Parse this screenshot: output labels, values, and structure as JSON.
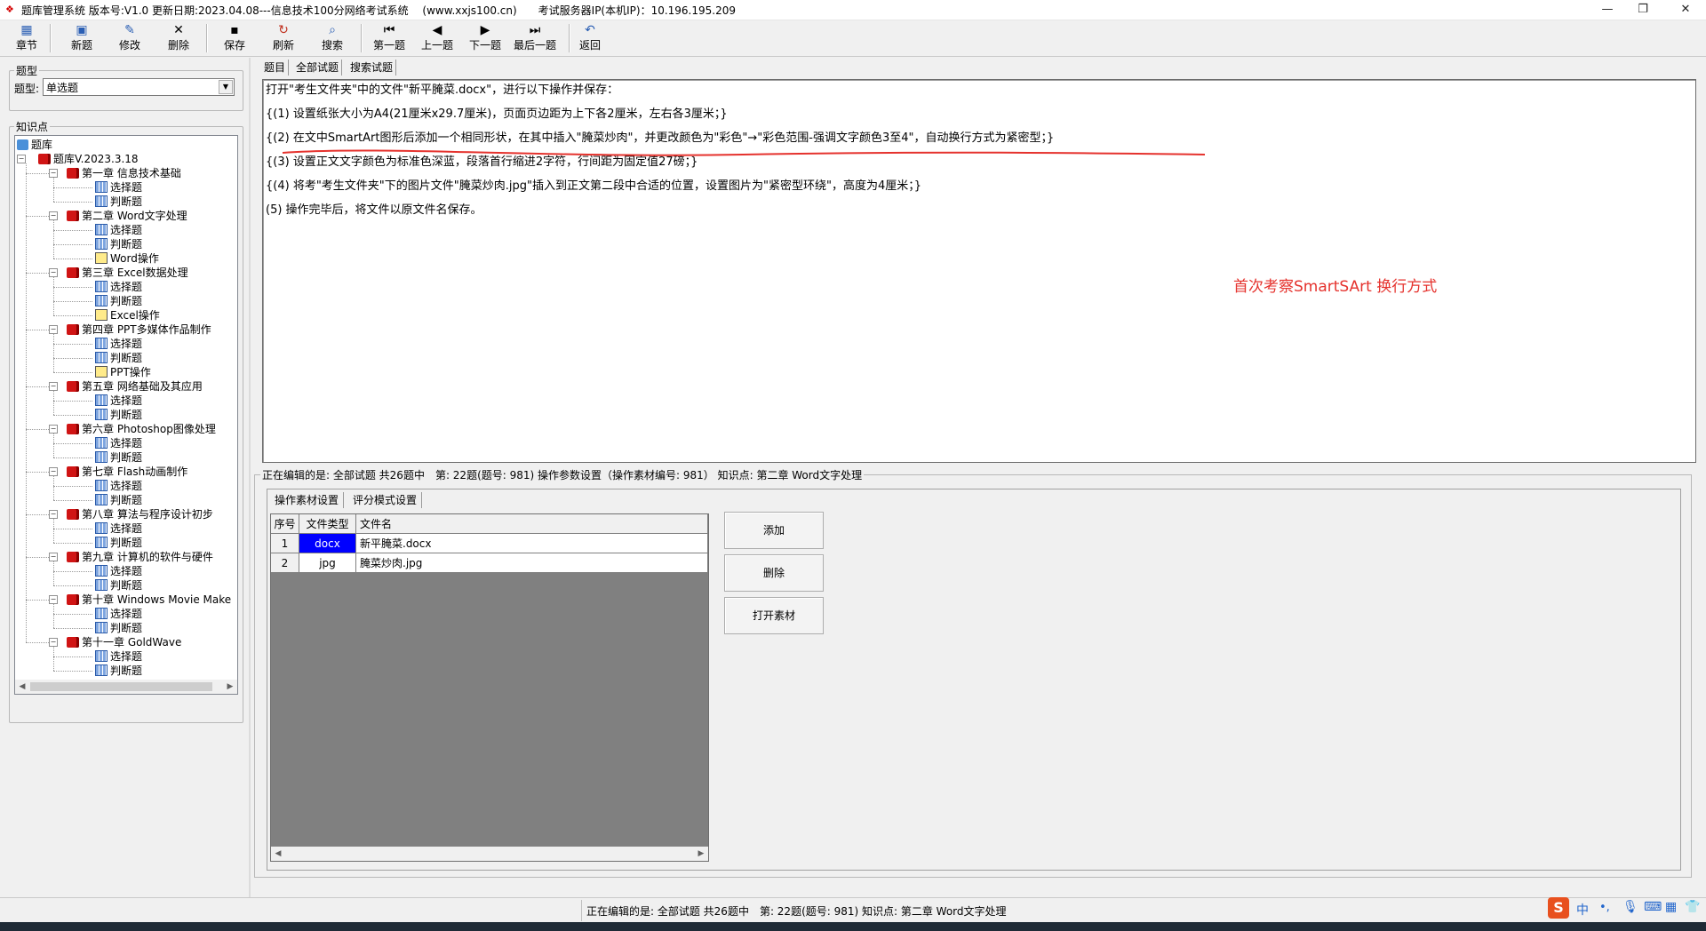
{
  "window": {
    "title": "题库管理系统 版本号:V1.0 更新日期:2023.04.08---信息技术100分网络考试系统　 (www.xxjs100.cn)　　考试服务器IP(本机IP)：10.196.195.209",
    "minimize": "—",
    "restore": "❐",
    "close": "✕"
  },
  "toolbar": {
    "chapter": "章节",
    "new": "新题",
    "edit": "修改",
    "delete": "删除",
    "save": "保存",
    "refresh": "刷新",
    "search": "搜索",
    "first": "第一题",
    "prev": "上一题",
    "next": "下一题",
    "last": "最后一题",
    "back": "返回"
  },
  "left": {
    "type_group": "题型",
    "type_label": "题型:",
    "type_value": "单选题",
    "kp_group": "知识点",
    "tree": {
      "root": "题库",
      "bank": "题库V.2023.3.18",
      "chapters": [
        {
          "label": "第一章 信息技术基础",
          "children": [
            "选择题",
            "判断题"
          ]
        },
        {
          "label": "第二章 Word文字处理",
          "children": [
            "选择题",
            "判断题",
            "Word操作"
          ]
        },
        {
          "label": "第三章 Excel数据处理",
          "children": [
            "选择题",
            "判断题",
            "Excel操作"
          ]
        },
        {
          "label": "第四章 PPT多媒体作品制作",
          "children": [
            "选择题",
            "判断题",
            "PPT操作"
          ]
        },
        {
          "label": "第五章 网络基础及其应用",
          "children": [
            "选择题",
            "判断题"
          ]
        },
        {
          "label": "第六章 Photoshop图像处理",
          "children": [
            "选择题",
            "判断题"
          ]
        },
        {
          "label": "第七章 Flash动画制作",
          "children": [
            "选择题",
            "判断题"
          ]
        },
        {
          "label": "第八章 算法与程序设计初步",
          "children": [
            "选择题",
            "判断题"
          ]
        },
        {
          "label": "第九章 计算机的软件与硬件",
          "children": [
            "选择题",
            "判断题"
          ]
        },
        {
          "label": "第十章 Windows Movie Make",
          "children": [
            "选择题",
            "判断题"
          ]
        },
        {
          "label": "第十一章 GoldWave",
          "children": [
            "选择题",
            "判断题"
          ]
        }
      ]
    }
  },
  "tabs": [
    "题目",
    "全部试题",
    "搜索试题"
  ],
  "question": {
    "lines": [
      "打开\"考生文件夹\"中的文件\"新平腌菜.docx\"，进行以下操作并保存：",
      "{(1) 设置纸张大小为A4(21厘米x29.7厘米)，页面页边距为上下各2厘米，左右各3厘米；}",
      "{(2) 在文中SmartArt图形后添加一个相同形状，在其中插入\"腌菜炒肉\"，并更改颜色为\"彩色\"→\"彩色范围-强调文字颜色3至4\"，自动换行方式为紧密型；}",
      "{(3) 设置正文文字颜色为标准色深蓝，段落首行缩进2字符，行间距为固定值27磅；}",
      "{(4) 将考\"考生文件夹\"下的图片文件\"腌菜炒肉.jpg\"插入到正文第二段中合适的位置，设置图片为\"紧密型环绕\"，高度为4厘米；}",
      "(5) 操作完毕后，将文件以原文件名保存。"
    ],
    "note": "首次考察SmartSArt  换行方式"
  },
  "editing": {
    "caption": "正在编辑的是: 全部试题 共26题中　第: 22题(题号: 981) 操作参数设置（操作素材编号: 981）  知识点: 第二章 Word文字处理",
    "tabs": [
      "操作素材设置",
      "评分模式设置"
    ],
    "table": {
      "headers": [
        "序号",
        "文件类型",
        "文件名"
      ],
      "rows": [
        [
          "1",
          "docx",
          "新平腌菜.docx"
        ],
        [
          "2",
          "jpg",
          "腌菜炒肉.jpg"
        ]
      ]
    },
    "buttons": {
      "add": "添加",
      "delete": "删除",
      "open": "打开素材"
    }
  },
  "statusbar": {
    "text": "正在编辑的是: 全部试题 共26题中　第: 22题(题号: 981)  知识点: 第二章 Word文字处理"
  },
  "ime": {
    "logo": "S",
    "lang": "中"
  },
  "colors": {
    "note_red": "#e5322d",
    "select_blue": "#0000ff",
    "grid_gray": "#808080"
  }
}
